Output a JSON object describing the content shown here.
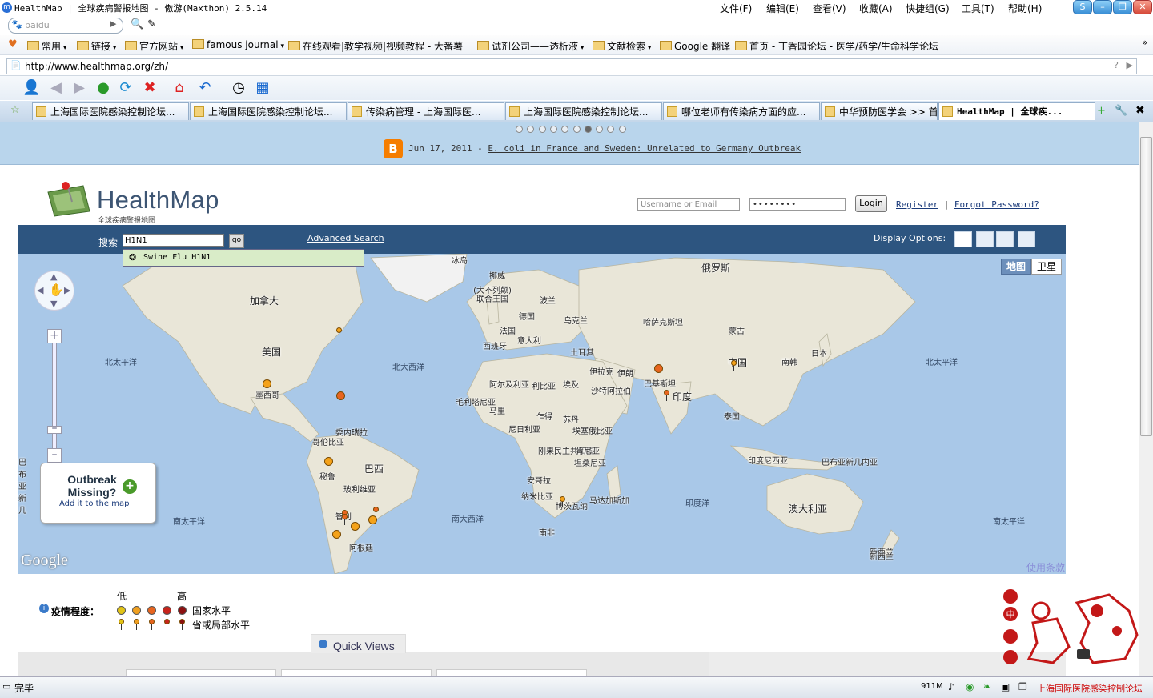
{
  "window": {
    "title": "HealthMap | 全球疾病警报地图 - 傲游(Maxthon) 2.5.14",
    "menu": [
      "文件(F)",
      "编辑(E)",
      "查看(V)",
      "收藏(A)",
      "快捷组(G)",
      "工具(T)",
      "帮助(H)"
    ]
  },
  "search": {
    "placeholder": "baidu"
  },
  "favorites": [
    "常用",
    "链接",
    "官方网站",
    "famous journal",
    "在线观看|教学视频|视频教程 - 大番薯",
    "试剂公司——透析液",
    "文献检索",
    "Google 翻译",
    "首页 - 丁香园论坛 - 医学/药学/生命科学论坛"
  ],
  "address": "http://www.healthmap.org/zh/",
  "tabs": [
    "上海国际医院感染控制论坛...",
    "上海国际医院感染控制论坛...",
    "传染病管理 - 上海国际医...",
    "上海国际医院感染控制论坛...",
    "哪位老师有传染病方面的应...",
    "中华预防医学会 >> 首页",
    "HealthMap | 全球疾..."
  ],
  "news": {
    "date": "Jun 17, 2011 - ",
    "headline": "E. coli in France and Sweden: Unrelated to Germany Outbreak"
  },
  "header": {
    "logo": "HealthMap",
    "logo_sub": "全球疾病警报地图",
    "username_placeholder": "Username or Email",
    "password_mask": "••••••••",
    "login": "Login",
    "register": "Register",
    "forgot": "Forgot Password?"
  },
  "searchbar": {
    "label": "搜索",
    "value": "H1N1",
    "go": "go",
    "advanced": "Advanced Search",
    "display_options": "Display Options:",
    "suggestion": "Swine Flu H1N1"
  },
  "map": {
    "type_map": "地图",
    "type_sat": "卫星",
    "google": "Google",
    "terms": "使用条款",
    "labels": [
      {
        "t": "冰岛"
      },
      {
        "t": "俄罗斯"
      },
      {
        "t": "挪威"
      },
      {
        "t": "加拿大"
      },
      {
        "t": "(大不列颠)联合王国"
      },
      {
        "t": "波兰"
      },
      {
        "t": "德国"
      },
      {
        "t": "乌克兰"
      },
      {
        "t": "哈萨克斯坦"
      },
      {
        "t": "蒙古"
      },
      {
        "t": "法国"
      },
      {
        "t": "意大利"
      },
      {
        "t": "西班牙"
      },
      {
        "t": "土耳其"
      },
      {
        "t": "中国"
      },
      {
        "t": "日本"
      },
      {
        "t": "南韩"
      },
      {
        "t": "美国"
      },
      {
        "t": "北太平洋"
      },
      {
        "t": "北大西洋"
      },
      {
        "t": "伊拉克"
      },
      {
        "t": "伊朗"
      },
      {
        "t": "阿尔及利亚"
      },
      {
        "t": "利比亚"
      },
      {
        "t": "埃及"
      },
      {
        "t": "沙特阿拉伯"
      },
      {
        "t": "巴基斯坦"
      },
      {
        "t": "印度"
      },
      {
        "t": "墨西哥"
      },
      {
        "t": "毛利塔尼亚"
      },
      {
        "t": "马里"
      },
      {
        "t": "乍得"
      },
      {
        "t": "苏丹"
      },
      {
        "t": "泰国"
      },
      {
        "t": "尼日利亚"
      },
      {
        "t": "埃塞俄比亚"
      },
      {
        "t": "委内瑞拉"
      },
      {
        "t": "哥伦比亚"
      },
      {
        "t": "刚果民主共和国"
      },
      {
        "t": "肯尼亚"
      },
      {
        "t": "坦桑尼亚"
      },
      {
        "t": "巴西"
      },
      {
        "t": "秘鲁"
      },
      {
        "t": "安哥拉"
      },
      {
        "t": "印度尼西亚"
      },
      {
        "t": "巴布亚新几内亚"
      },
      {
        "t": "玻利维亚"
      },
      {
        "t": "纳米比亚"
      },
      {
        "t": "博茨瓦纳"
      },
      {
        "t": "马达加斯加"
      },
      {
        "t": "印度洋"
      },
      {
        "t": "澳大利亚"
      },
      {
        "t": "智利"
      },
      {
        "t": "南大西洋"
      },
      {
        "t": "南非"
      },
      {
        "t": "南太平洋"
      },
      {
        "t": "阿根廷"
      },
      {
        "t": "新西兰"
      },
      {
        "t": "巴布亚新几"
      }
    ],
    "markers": [
      {
        "color": "#f4a21a",
        "kind": "pin"
      },
      {
        "color": "#f4a21a",
        "kind": "dot"
      },
      {
        "color": "#e8651f",
        "kind": "dot"
      },
      {
        "color": "#e8651f",
        "kind": "dot"
      },
      {
        "color": "#f4a21a",
        "kind": "pin"
      },
      {
        "color": "#e8651f",
        "kind": "pin"
      },
      {
        "color": "#f4a21a",
        "kind": "dot"
      },
      {
        "color": "#e8651f",
        "kind": "pin"
      },
      {
        "color": "#f4a21a",
        "kind": "dot"
      },
      {
        "color": "#f4a21a",
        "kind": "dot"
      },
      {
        "color": "#e8651f",
        "kind": "pin"
      },
      {
        "color": "#f4a21a",
        "kind": "pin"
      },
      {
        "color": "#e8651f",
        "kind": "pin"
      },
      {
        "color": "#f4a21a",
        "kind": "dot"
      }
    ]
  },
  "outbreak": {
    "title": "Outbreak Missing?",
    "link": "Add it to the map"
  },
  "legend": {
    "low": "低",
    "high": "高",
    "label": "疫情程度：",
    "national": "国家水平",
    "provincial": "省或局部水平",
    "colors": [
      "#e2c416",
      "#f0a020",
      "#e8651f",
      "#c8241b",
      "#8c1010"
    ]
  },
  "quickviews": "Quick Views",
  "status": {
    "text": "完毕",
    "mem": "911M",
    "right": "上海国际医院感染控制论坛"
  }
}
